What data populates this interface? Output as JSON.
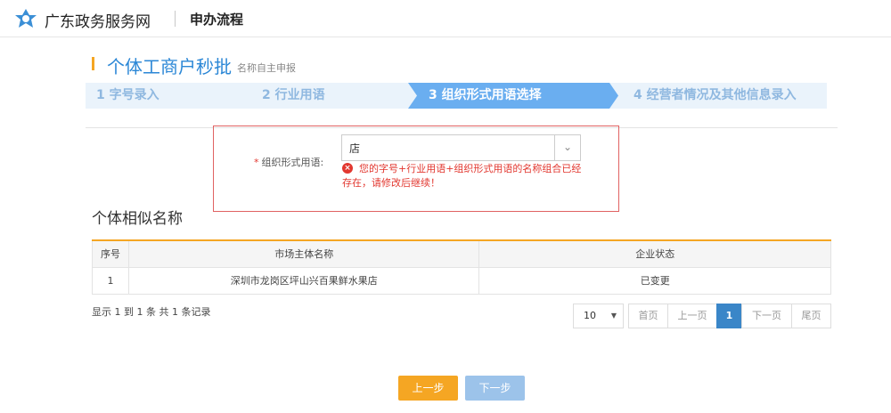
{
  "header": {
    "site_name": "广东政务服务网",
    "page_subtitle": "申办流程"
  },
  "title": {
    "main": "个体工商户秒批",
    "sub": "名称自主申报"
  },
  "steps": [
    {
      "label": "1 字号录入",
      "active": false
    },
    {
      "label": "2 行业用语",
      "active": false
    },
    {
      "label": "3 组织形式用语选择",
      "active": true
    },
    {
      "label": "4 经营者情况及其他信息录入",
      "active": false
    }
  ],
  "form": {
    "field_label": "组织形式用语:",
    "required_mark": "*",
    "select_value": "店",
    "error_message": "您的字号+行业用语+组织形式用语的名称组合已经存在，请修改后继续！"
  },
  "similar": {
    "title": "个体相似名称",
    "columns": [
      "序号",
      "市场主体名称",
      "企业状态"
    ],
    "rows": [
      [
        "1",
        "深圳市龙岗区坪山兴百果鲜水果店",
        "已变更"
      ]
    ],
    "records_text": "显示 1 到 1 条 共 1 条记录"
  },
  "pager": {
    "page_size": "10",
    "first": "首页",
    "prev": "上一页",
    "current": "1",
    "next": "下一页",
    "last": "尾页"
  },
  "buttons": {
    "prev": "上一步",
    "next": "下一步"
  },
  "colors": {
    "brand_blue": "#2b87d6",
    "accent_orange": "#f5a623",
    "error_red": "#e2372f",
    "active_step": "#6aaef0"
  }
}
